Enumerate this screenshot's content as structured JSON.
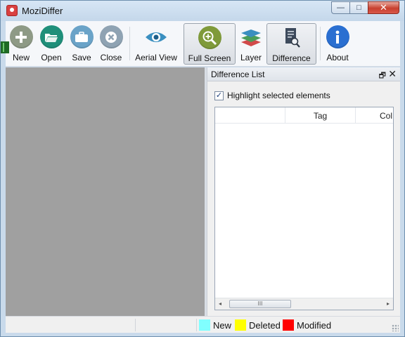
{
  "window": {
    "title": "MoziDiffer",
    "controls": {
      "minimize": "—",
      "maximize": "□",
      "close": "✕"
    }
  },
  "toolbar": {
    "buttons": [
      {
        "label": "New",
        "icon": "plus-icon",
        "color": "#8e9a86"
      },
      {
        "label": "Open",
        "icon": "folder-open-icon",
        "color": "#1f8f7a"
      },
      {
        "label": "Save",
        "icon": "briefcase-icon",
        "color": "#6aa3c8"
      },
      {
        "label": "Close",
        "icon": "close-circle-icon",
        "color": "#8fa3b3"
      },
      {
        "label": "Aerial View",
        "icon": "eye-icon",
        "color": "#3a8fc0"
      },
      {
        "label": "Full Screen",
        "icon": "zoom-in-icon",
        "color": "#7f9a3a",
        "active": true
      },
      {
        "label": "Layer",
        "icon": "layers-icon",
        "color": "#4a9d5a"
      },
      {
        "label": "Difference",
        "icon": "document-search-icon",
        "color": "#3d4a5c",
        "active": true
      },
      {
        "label": "About",
        "icon": "info-icon",
        "color": "#2a6fd1"
      }
    ]
  },
  "panel": {
    "title": "Difference List",
    "float_glyph": "🗗",
    "close_glyph": "✕",
    "highlight_checkbox": {
      "label": "Highlight selected elements",
      "checked": true,
      "mark": "✓"
    },
    "columns": [
      "",
      "Tag",
      "Col"
    ],
    "scroll": {
      "left": "◂",
      "right": "▸",
      "thumb": "III"
    }
  },
  "statusbar": {
    "legend": [
      {
        "label": "New",
        "color": "#80ffff"
      },
      {
        "label": "Deleted",
        "color": "#ffff00"
      },
      {
        "label": "Modified",
        "color": "#ff0000"
      }
    ]
  }
}
